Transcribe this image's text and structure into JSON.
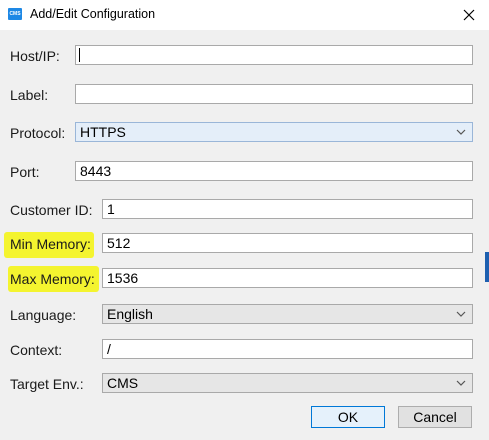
{
  "window": {
    "title": "Add/Edit Configuration",
    "app_icon_text": "CMS",
    "close_icon": "close-icon"
  },
  "form": {
    "host": {
      "label": "Host/IP:",
      "value": ""
    },
    "label_field": {
      "label": "Label:",
      "value": ""
    },
    "protocol": {
      "label": "Protocol:",
      "value": "HTTPS"
    },
    "port": {
      "label": "Port:",
      "value": "8443"
    },
    "customer_id": {
      "label": "Customer ID:",
      "value": "1"
    },
    "min_memory": {
      "label": "Min Memory:",
      "value": "512"
    },
    "max_memory": {
      "label": "Max Memory:",
      "value": "1536"
    },
    "language": {
      "label": "Language:",
      "value": "English"
    },
    "context": {
      "label": "Context:",
      "value": "/"
    },
    "target_env": {
      "label": "Target Env.:",
      "value": "CMS"
    }
  },
  "buttons": {
    "ok": "OK",
    "cancel": "Cancel"
  },
  "colors": {
    "highlight": "#f4f41a",
    "accent": "#0078d7"
  }
}
